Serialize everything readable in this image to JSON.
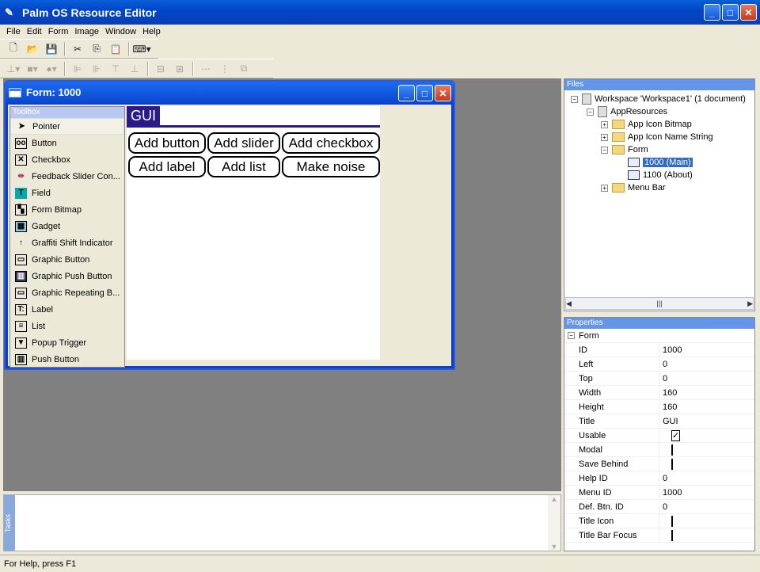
{
  "app": {
    "title": "Palm OS Resource Editor"
  },
  "menu": [
    "File",
    "Edit",
    "Form",
    "Image",
    "Window",
    "Help"
  ],
  "form_window": {
    "title": "Form: 1000"
  },
  "toolbox": {
    "header": "Toolbox",
    "items": [
      "Pointer",
      "Button",
      "Checkbox",
      "Feedback Slider Con...",
      "Field",
      "Form Bitmap",
      "Gadget",
      "Graffiti Shift Indicator",
      "Graphic Button",
      "Graphic Push Button",
      "Graphic Repeating B...",
      "Label",
      "List",
      "Popup Trigger",
      "Push Button"
    ]
  },
  "canvas": {
    "form_title": "GUI",
    "buttons": [
      "Add button",
      "Add slider",
      "Add checkbox",
      "Add label",
      "Add list",
      "Make noise"
    ]
  },
  "files": {
    "header": "Files",
    "workspace": "Workspace 'Workspace1' (1 document)",
    "app_resources": "AppResources",
    "icon_bitmap": "App Icon Bitmap",
    "icon_name": "App Icon Name String",
    "form": "Form",
    "form_main": "1000 (Main)",
    "form_about": "1100 (About)",
    "menu_bar": "Menu Bar"
  },
  "properties": {
    "header": "Properties",
    "group": "Form",
    "rows": [
      {
        "k": "ID",
        "v": "1000"
      },
      {
        "k": "Left",
        "v": "0"
      },
      {
        "k": "Top",
        "v": "0"
      },
      {
        "k": "Width",
        "v": "160"
      },
      {
        "k": "Height",
        "v": "160"
      },
      {
        "k": "Title",
        "v": "GUI"
      },
      {
        "k": "Usable",
        "check": true
      },
      {
        "k": "Modal",
        "check": false
      },
      {
        "k": "Save Behind",
        "check": false
      },
      {
        "k": "Help ID",
        "v": "0"
      },
      {
        "k": "Menu ID",
        "v": "1000"
      },
      {
        "k": "Def. Btn. ID",
        "v": "0"
      },
      {
        "k": "Title Icon",
        "check": false
      },
      {
        "k": "Title Bar Focus",
        "check": false
      }
    ]
  },
  "tasks": {
    "label": "Tasks"
  },
  "status": {
    "text": "For Help, press F1"
  }
}
